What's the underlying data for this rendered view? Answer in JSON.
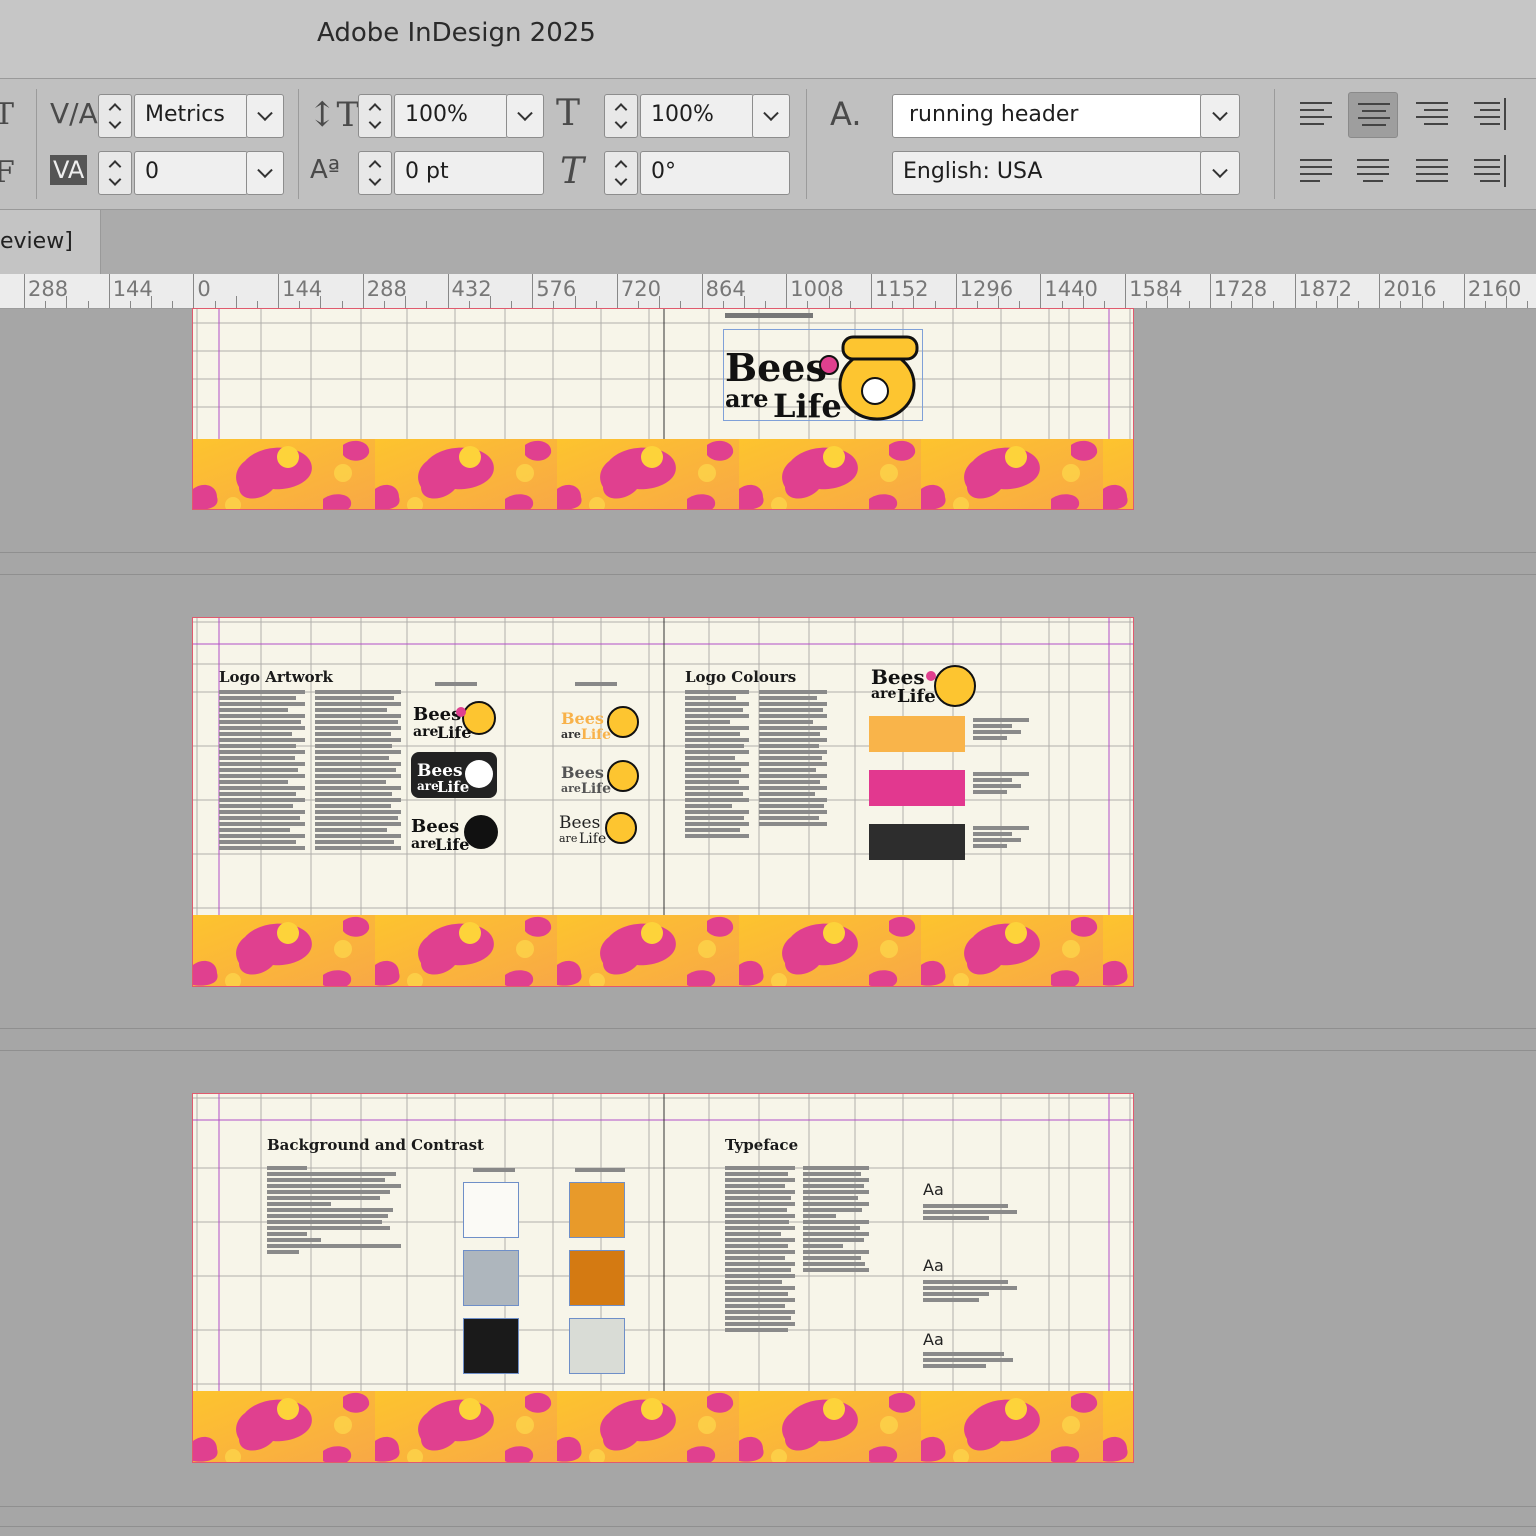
{
  "app": {
    "title": "Adobe InDesign 2025"
  },
  "control_panel": {
    "kerning_value": "Metrics",
    "tracking_value": "0",
    "vertical_scale": "100%",
    "horizontal_scale": "100%",
    "baseline_shift": "0 pt",
    "skew": "0°",
    "char_style_label": "A.",
    "char_style": "running header",
    "language": "English: USA",
    "active_alignment": "align-center"
  },
  "document_tab": {
    "label": "eview]"
  },
  "ruler": {
    "labels": [
      "288",
      "144",
      "0",
      "144",
      "288",
      "432",
      "576",
      "720",
      "864",
      "1008",
      "1152",
      "1296",
      "1440",
      "1584",
      "1728",
      "1872",
      "2016",
      "2160"
    ]
  },
  "spreads": [
    {
      "id": "spread-1",
      "logo_text": [
        "Bees",
        "are",
        "Life"
      ]
    },
    {
      "id": "spread-2",
      "left_heading": "Logo Artwork",
      "right_heading": "Logo Colours",
      "swatches": [
        "#f9b44a",
        "#e2388f",
        "#2d2d2d"
      ]
    },
    {
      "id": "spread-3",
      "left_heading": "Background and Contrast",
      "right_heading": "Typeface",
      "type_samples": [
        "Aa",
        "Aa",
        "Aa"
      ]
    }
  ],
  "colors": {
    "pink": "#e0408f",
    "yellow": "#fdc530",
    "orange": "#f8a640",
    "paper": "#f7f5e9"
  }
}
